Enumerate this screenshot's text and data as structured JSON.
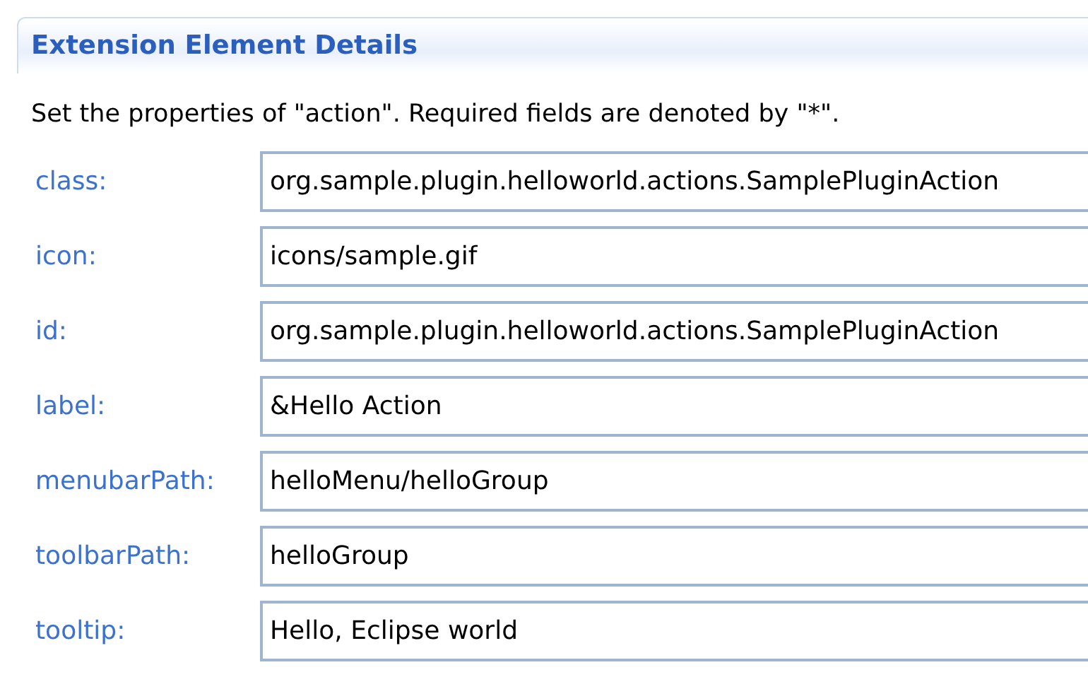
{
  "section": {
    "title": "Extension Element Details",
    "description": "Set the properties of \"action\". Required fields are denoted by \"*\"."
  },
  "fields": [
    {
      "label": "class:",
      "value": "org.sample.plugin.helloworld.actions.SamplePluginAction"
    },
    {
      "label": "icon:",
      "value": "icons/sample.gif"
    },
    {
      "label": "id:",
      "value": "org.sample.plugin.helloworld.actions.SamplePluginAction"
    },
    {
      "label": "label:",
      "value": "&Hello Action"
    },
    {
      "label": "menubarPath:",
      "value": "helloMenu/helloGroup"
    },
    {
      "label": "toolbarPath:",
      "value": "helloGroup"
    },
    {
      "label": "tooltip:",
      "value": "Hello, Eclipse world"
    }
  ]
}
